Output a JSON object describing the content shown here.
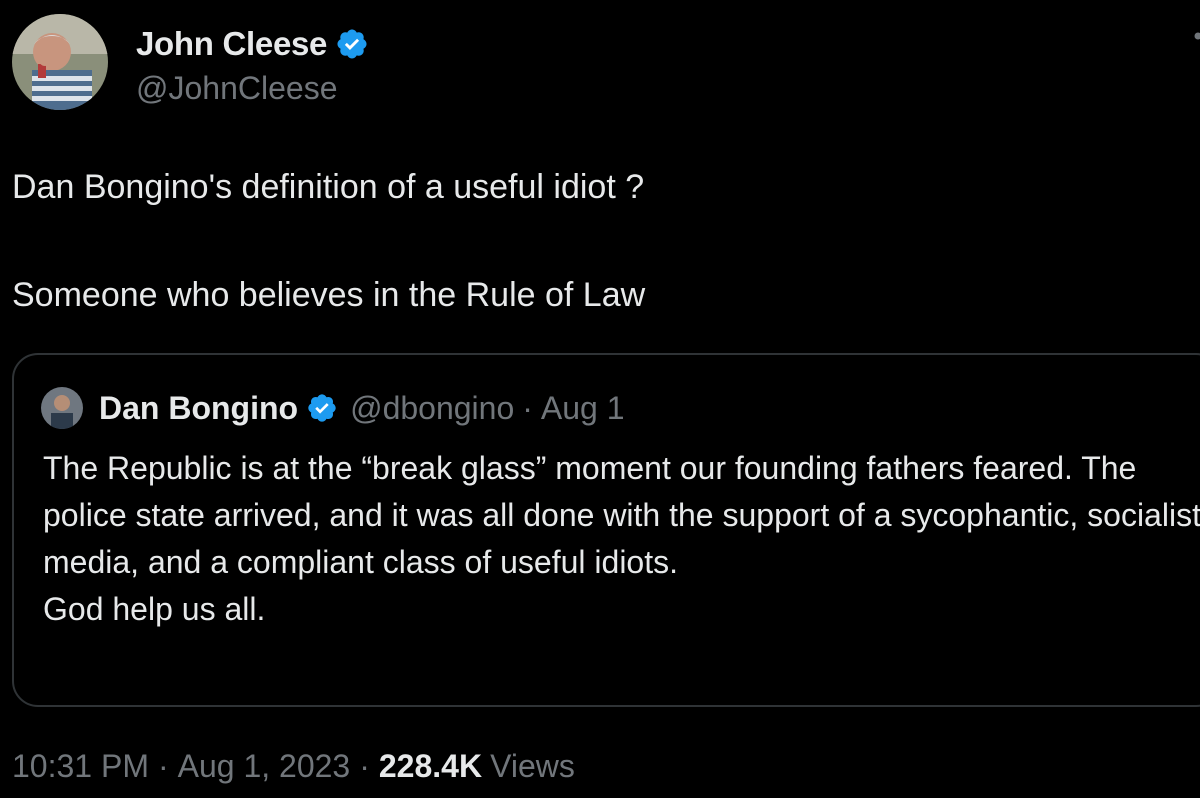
{
  "author": {
    "display_name": "John Cleese",
    "handle": "@JohnCleese",
    "verified": true
  },
  "tweet": {
    "text": "Dan Bongino's definition of a useful idiot ?\n\nSomeone who believes in the Rule of Law"
  },
  "quoted_tweet": {
    "display_name": "Dan Bongino",
    "handle": "@dbongino",
    "separator": "·",
    "date": "Aug 1",
    "verified": true,
    "text": "The Republic is at the “break glass” moment our founding fathers feared. The police state arrived, and it was all done with the support of a sycophantic, socialist media, and a compliant class of useful idiots.\nGod help us all."
  },
  "meta": {
    "time": "10:31 PM",
    "sep1": "·",
    "date": "Aug 1, 2023",
    "sep2": "·",
    "views_count": "228.4K",
    "views_label": "Views"
  },
  "colors": {
    "background": "#000000",
    "text_primary": "#e7e9ea",
    "text_secondary": "#71767b",
    "border": "#2f3336",
    "verified_blue": "#1d9bf0"
  },
  "icons": {
    "verified": "verified-badge-icon",
    "more": "more-options-icon"
  }
}
